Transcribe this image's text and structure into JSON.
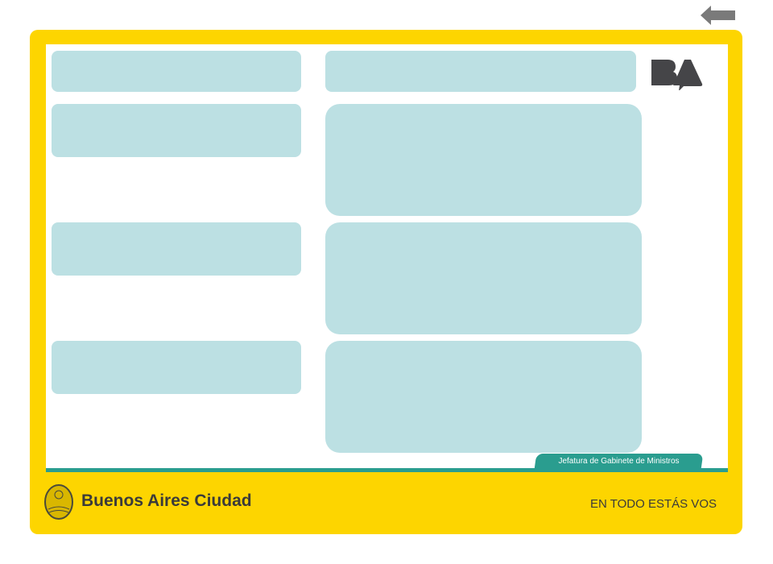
{
  "header": {
    "back_icon": "arrow-left-icon",
    "logo_text": "BA"
  },
  "footer": {
    "department": "Jefatura de Gabinete de Ministros",
    "brand": "Buenos Aires Ciudad",
    "slogan": "EN TODO ESTÁS VOS"
  },
  "colors": {
    "frame": "#fdd500",
    "accent": "#2a9d8f",
    "box": "#bce0e3",
    "text": "#3a3a3a"
  }
}
